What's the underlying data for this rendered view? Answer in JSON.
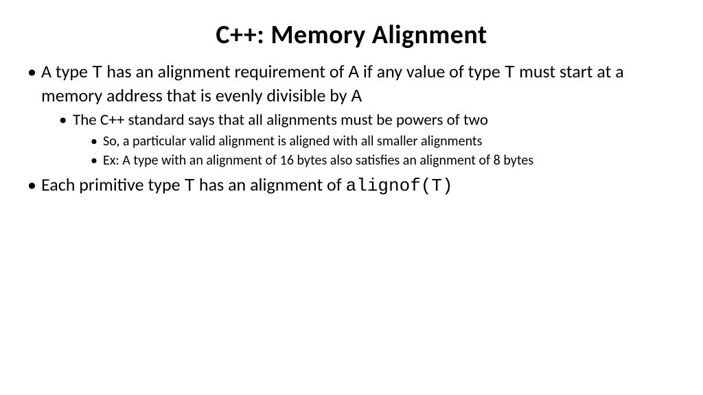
{
  "title": "C++: Memory Alignment",
  "bullets": {
    "b1": {
      "pre1": "A type ",
      "code1": "T",
      "mid1": " has an alignment requirement of ",
      "code2": "A",
      "mid2": " if any value of type ",
      "code3": "T",
      "mid3": " must start at a memory address that is evenly divisible by ",
      "code4": "A"
    },
    "b1_1": "The C++ standard says that all alignments must be powers of two",
    "b1_1_1": "So, a particular valid alignment is aligned with all smaller alignments",
    "b1_1_2": "Ex: A type with an alignment of 16 bytes also satisfies an alignment of 8 bytes",
    "b2": {
      "pre1": "Each primitive type ",
      "code1": "T",
      "mid1": " has an alignment of ",
      "code2": "alignof(T)"
    }
  }
}
